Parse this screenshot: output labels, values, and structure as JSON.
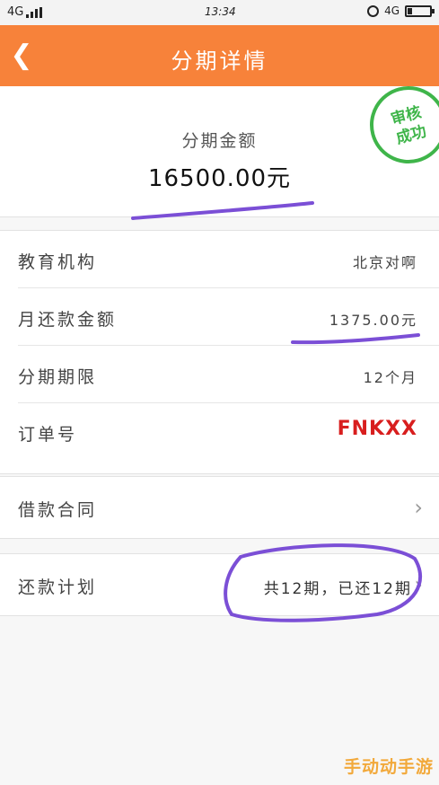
{
  "status_bar": {
    "network_left": "4G",
    "time": "13:34",
    "network_right": "4G",
    "alarm_icon": "alarm-clock-icon",
    "battery_level": 0.2
  },
  "header": {
    "back_icon": "chevron-left-icon",
    "title": "分期详情",
    "background": "#f7823a"
  },
  "summary": {
    "amount_label": "分期金额",
    "amount_value": "16500.00元",
    "stamp_text": "审核成功",
    "stamp_line1": "审核",
    "stamp_line2": "成功",
    "stamp_color": "#3fb54a"
  },
  "details": [
    {
      "label": "教育机构",
      "value": "北京对啊"
    },
    {
      "label": "月还款金额",
      "value": "1375.00元"
    },
    {
      "label": "分期期限",
      "value": "12个月"
    },
    {
      "label": "订单号",
      "value": "FNKXX"
    }
  ],
  "contract_row": {
    "label": "借款合同",
    "chevron_icon": "chevron-right-icon"
  },
  "plan_row": {
    "label": "还款计划",
    "value": "共12期，已还12期",
    "chevron_icon": "chevron-right-icon"
  },
  "watermark": "手动动手游",
  "annotation_color": "#7b4fd6"
}
